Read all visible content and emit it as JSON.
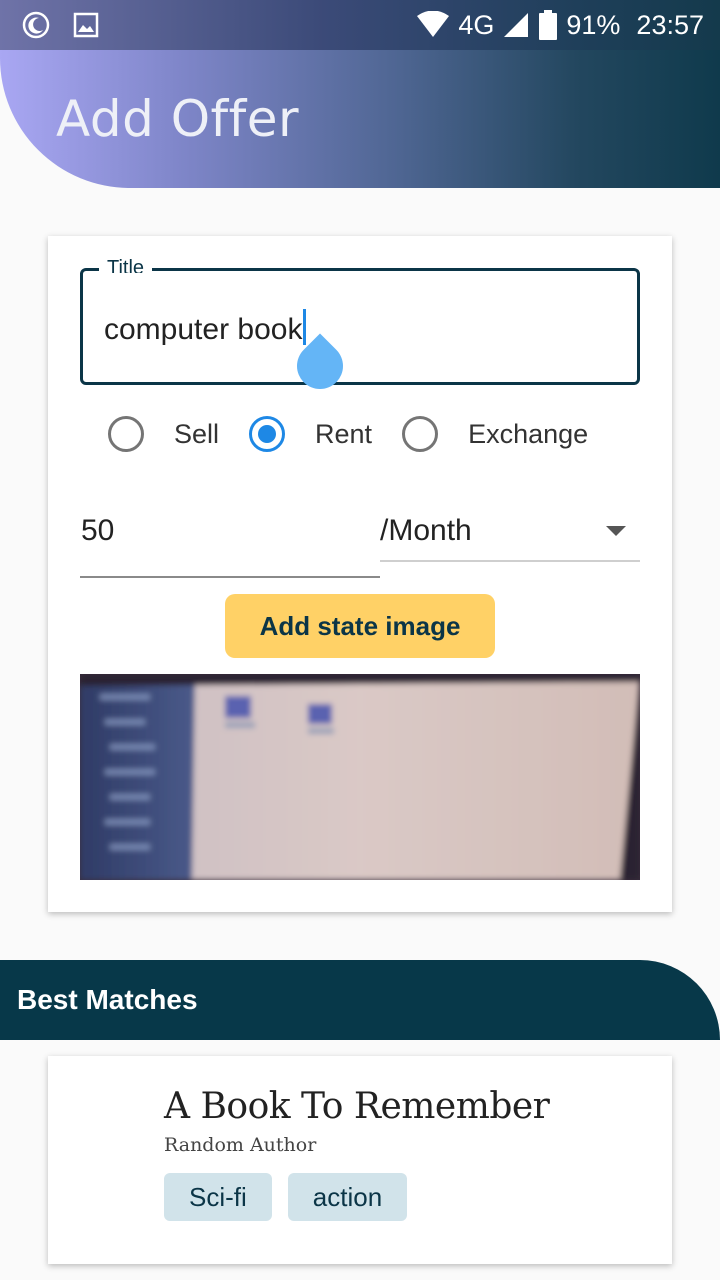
{
  "status_bar": {
    "network": "4G",
    "battery": "91%",
    "time": "23:57",
    "icons": [
      "moon-icon",
      "image-icon",
      "wifi-icon",
      "signal-icon",
      "battery-icon"
    ]
  },
  "header": {
    "title": "Add Offer"
  },
  "form": {
    "title_label": "Title",
    "title_value": "computer book",
    "offer_types": [
      {
        "label": "Sell",
        "selected": false
      },
      {
        "label": "Rent",
        "selected": true
      },
      {
        "label": "Exchange",
        "selected": false
      }
    ],
    "price_value": "50",
    "period_value": "/Month",
    "state_image_button": "Add state image"
  },
  "matches": {
    "heading": "Best Matches",
    "items": [
      {
        "title": "A Book To Remember",
        "author": "Random Author",
        "tags": [
          "Sci-fi",
          "action"
        ]
      }
    ]
  },
  "colors": {
    "accent": "#1e88e5",
    "primary_dark": "#073849",
    "button_yellow": "#ffd166",
    "tag_bg": "#d1e3ea"
  }
}
